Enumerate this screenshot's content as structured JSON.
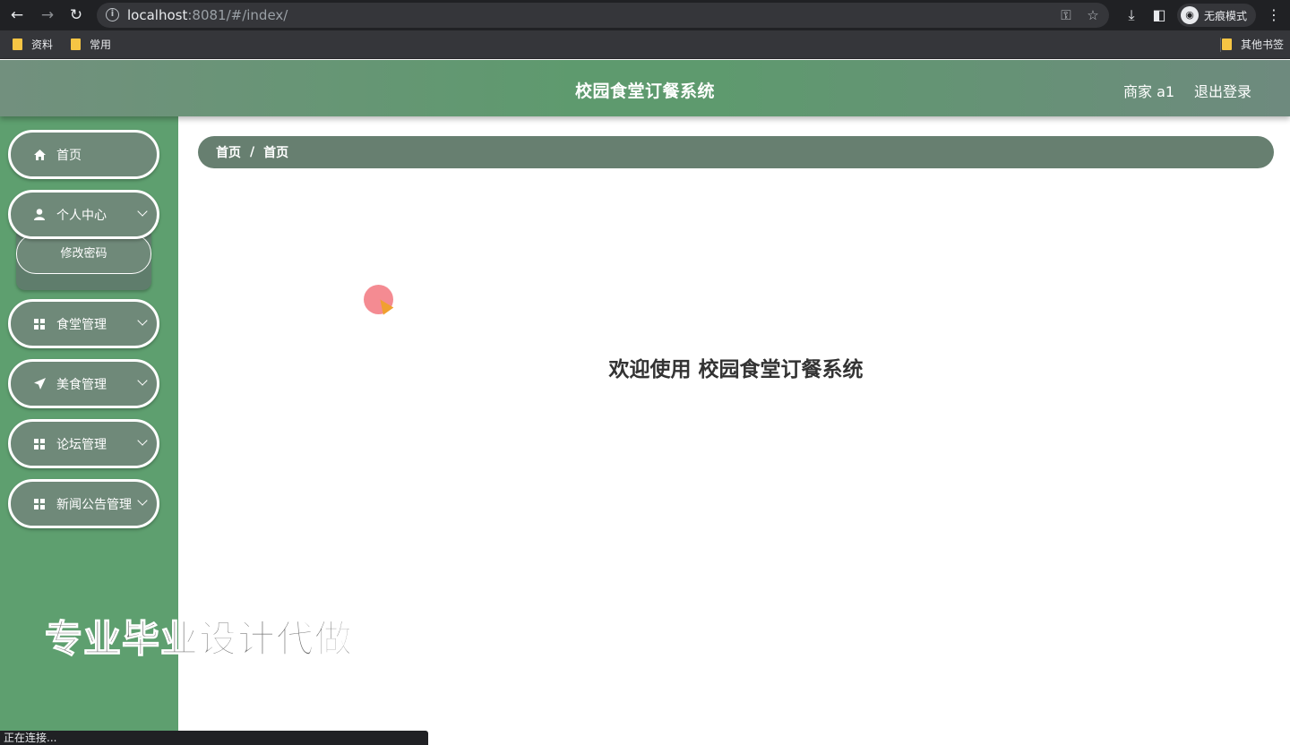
{
  "browser": {
    "url_host": "localhost",
    "url_rest": ":8081/#/index/",
    "profile_label": "无痕模式",
    "bookmarks": [
      "资料",
      "常用"
    ],
    "other_bookmarks": "其他书签",
    "status_text": "正在连接..."
  },
  "header": {
    "title": "校园食堂订餐系统",
    "user_role": "商家 a1",
    "logout": "退出登录"
  },
  "sidebar": {
    "items": [
      {
        "label": "首页",
        "icon": "home-icon"
      },
      {
        "label": "个人中心",
        "icon": "user-icon"
      },
      {
        "label": "食堂管理",
        "icon": "grid-icon"
      },
      {
        "label": "美食管理",
        "icon": "send-icon"
      },
      {
        "label": "论坛管理",
        "icon": "grid-icon"
      },
      {
        "label": "新闻公告管理",
        "icon": "grid-icon"
      }
    ],
    "submenu": {
      "label": "修改密码"
    }
  },
  "breadcrumb": {
    "home": "首页",
    "current": "首页"
  },
  "welcome": "欢迎使用 校园食堂订餐系统",
  "watermark": "专业毕业设计代做"
}
